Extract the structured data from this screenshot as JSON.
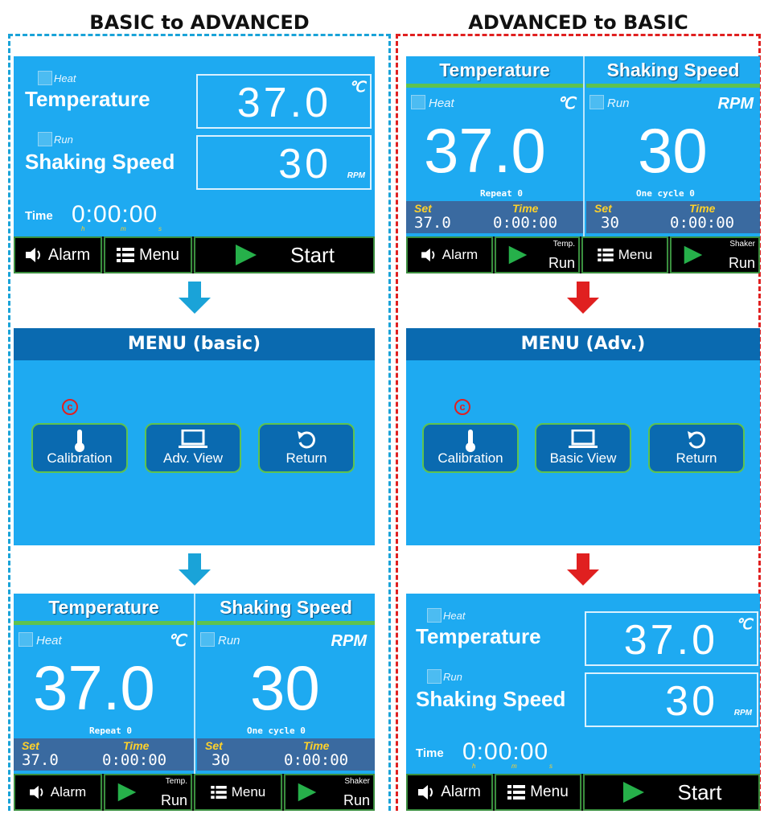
{
  "titles": {
    "left": "BASIC to ADVANCED",
    "right": "ADVANCED to BASIC"
  },
  "basic": {
    "heat_label": "Heat",
    "temperature_label": "Temperature",
    "temperature_value": "37.0",
    "temperature_unit": "℃",
    "run_label": "Run",
    "shaking_label": "Shaking Speed",
    "shaking_value": "30",
    "shaking_unit": "RPM",
    "time_label": "Time",
    "time_value": "0:00:00",
    "h": "h",
    "m": "m",
    "s": "s",
    "alarm_label": "Alarm",
    "menu_label": "Menu",
    "start_label": "Start"
  },
  "advanced": {
    "temp_header": "Temperature",
    "shake_header": "Shaking Speed",
    "heat_label": "Heat",
    "run_label": "Run",
    "temp_unit": "℃",
    "rpm_unit": "RPM",
    "temp_value": "37.0",
    "rpm_value": "30",
    "repeat_text": "Repeat 0",
    "cycle_text": "One cycle 0",
    "set_label": "Set",
    "time_label": "Time",
    "set_temp": "37.0",
    "set_rpm": "30",
    "time_temp": "0:00:00",
    "time_rpm": "0:00:00",
    "alarm_label": "Alarm",
    "menu_label": "Menu",
    "temp_run_small": "Temp.",
    "shaker_run_small": "Shaker",
    "run_label_btn": "Run"
  },
  "menu_basic": {
    "title": "MENU (basic)",
    "calibration": "Calibration",
    "view": "Adv. View",
    "return": "Return",
    "mark": "c"
  },
  "menu_adv": {
    "title": "MENU (Adv.)",
    "calibration": "Calibration",
    "view": "Basic View",
    "return": "Return",
    "mark": "c"
  },
  "colors": {
    "screen": "#1eaaf1",
    "left_arrow": "#1aa3d8",
    "right_arrow": "#e02020",
    "button_border": "#5ec24f"
  },
  "icons": [
    "speaker-icon",
    "list-icon",
    "play-icon",
    "thermometer-icon",
    "laptop-icon",
    "return-icon",
    "arrow-down-icon"
  ]
}
